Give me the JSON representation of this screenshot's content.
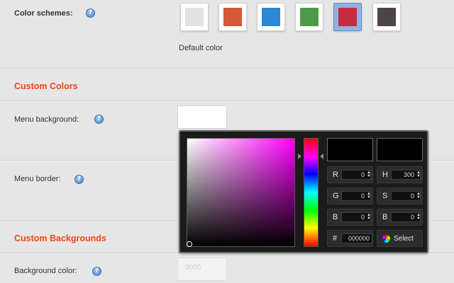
{
  "color_schemes": {
    "label": "Color schemes:",
    "swatches": [
      {
        "name": "light-gray",
        "color": "#e2e2e2"
      },
      {
        "name": "orange",
        "color": "#d35a34"
      },
      {
        "name": "blue",
        "color": "#2a88d4"
      },
      {
        "name": "green",
        "color": "#4f9a48"
      },
      {
        "name": "crimson",
        "color": "#c42b3f",
        "selected": true
      },
      {
        "name": "dark-brown",
        "color": "#4d4544"
      }
    ],
    "caption": "Default color"
  },
  "custom_colors": {
    "title": "Custom Colors",
    "menu_background_label": "Menu background:",
    "menu_border_label": "Menu border:"
  },
  "custom_backgrounds": {
    "title": "Custom Backgrounds",
    "background_color_label": "Background color:",
    "background_color_placeholder": "0000"
  },
  "help_icon_glyph": "?",
  "color_picker": {
    "hue_gradient": "red-magenta-blue-cyan-green-yellow-red",
    "current_color": "#000000",
    "previous_color": "#000000",
    "fields": {
      "r": {
        "label": "R",
        "value": "0"
      },
      "g": {
        "label": "G",
        "value": "0"
      },
      "b": {
        "label": "B",
        "value": "0"
      },
      "h": {
        "label": "H",
        "value": "300"
      },
      "s": {
        "label": "S",
        "value": "0"
      },
      "bv": {
        "label": "B",
        "value": "0"
      },
      "hex": {
        "label": "#",
        "value": "000000"
      }
    },
    "select_label": "Select"
  }
}
